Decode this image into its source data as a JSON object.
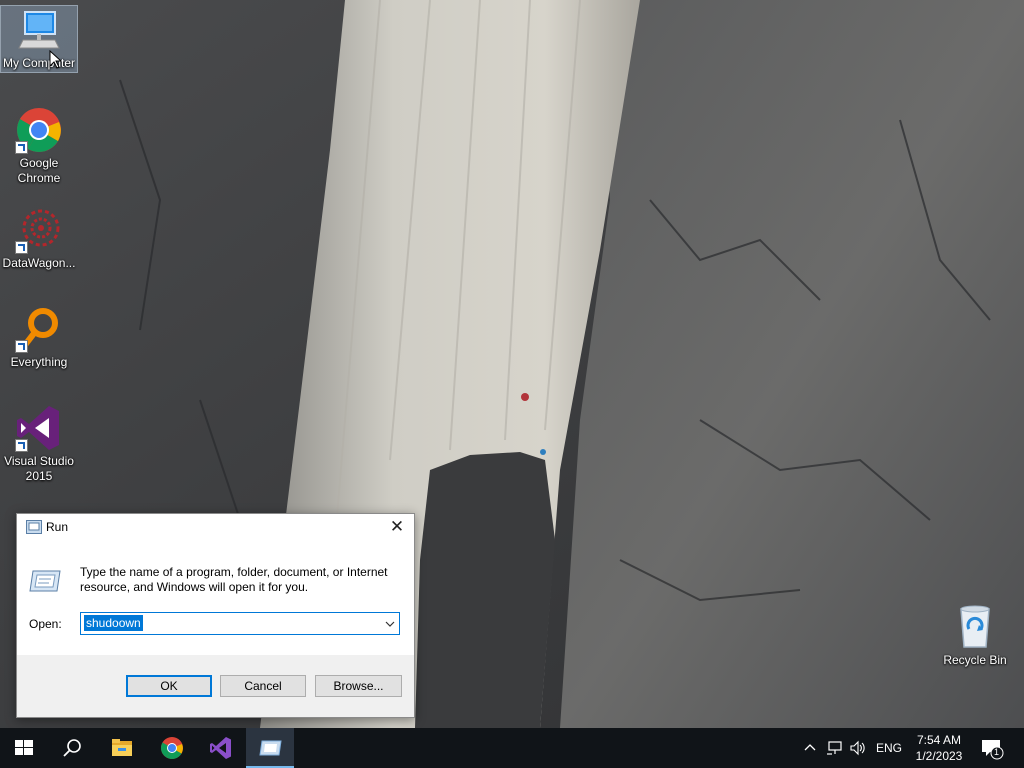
{
  "desktop": {
    "icons": [
      {
        "label": "My Computer",
        "icon": "computer-icon"
      },
      {
        "label": "Google Chrome",
        "icon": "chrome-icon"
      },
      {
        "label": "DataWagon...",
        "icon": "datawagon-icon"
      },
      {
        "label": "Everything",
        "icon": "everything-search-icon"
      },
      {
        "label": "Visual Studio 2015",
        "icon": "visual-studio-icon"
      },
      {
        "label": "Recycle Bin",
        "icon": "recycle-bin-icon"
      }
    ]
  },
  "run_dialog": {
    "title": "Run",
    "close_glyph": "✕",
    "description": "Type the name of a program, folder, document, or Internet resource, and Windows will open it for you.",
    "open_label": "Open:",
    "open_value": "shudoown",
    "ok_label": "OK",
    "cancel_label": "Cancel",
    "browse_label": "Browse..."
  },
  "taskbar": {
    "buttons": [
      "start-icon",
      "search-icon",
      "file-explorer-icon",
      "chrome-icon",
      "visual-studio-icon",
      "run-icon"
    ],
    "language": "ENG",
    "time": "7:54 AM",
    "date": "1/2/2023",
    "notification_count": "1"
  },
  "colors": {
    "accent": "#0078d7",
    "taskbar": "#101418"
  }
}
